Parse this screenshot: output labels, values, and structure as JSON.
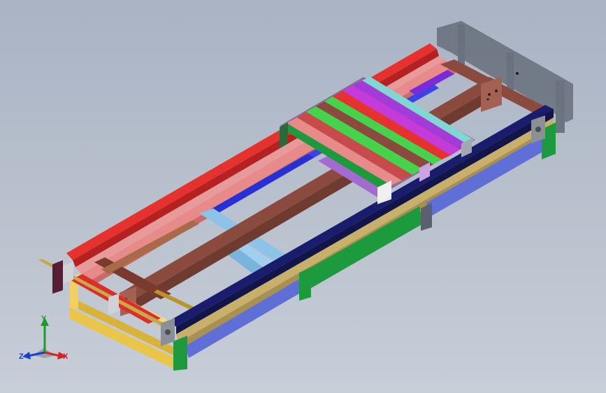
{
  "viewport": {
    "background_top": "#a9b3c4",
    "background_bottom": "#c7ced8"
  },
  "model": {
    "description_icon": "conveyor-frame-assembly",
    "colors": {
      "red_rail": "#e5322e",
      "pink_rail": "#e89a9a",
      "brown_beam": "#8a4b3e",
      "dark_navy_rail": "#1a1d6e",
      "tan_rail": "#c8b06a",
      "blue_leg": "#5f6fd6",
      "green_leg": "#1e9a3e",
      "yellow_frame": "#e9c64a",
      "light_blue": "#8cc3e6",
      "magenta": "#c43bd9",
      "lime": "#46d24a",
      "cyan": "#7fd6d2",
      "salmon": "#e88a8a",
      "purple": "#7a2ad6",
      "blue_beam": "#2630d6"
    }
  },
  "triad": {
    "y_label": "Y",
    "z_label": "Z",
    "x_label": "X",
    "y_color": "#1e9a2a",
    "z_color": "#1d3fc8",
    "x_color": "#d42424"
  }
}
